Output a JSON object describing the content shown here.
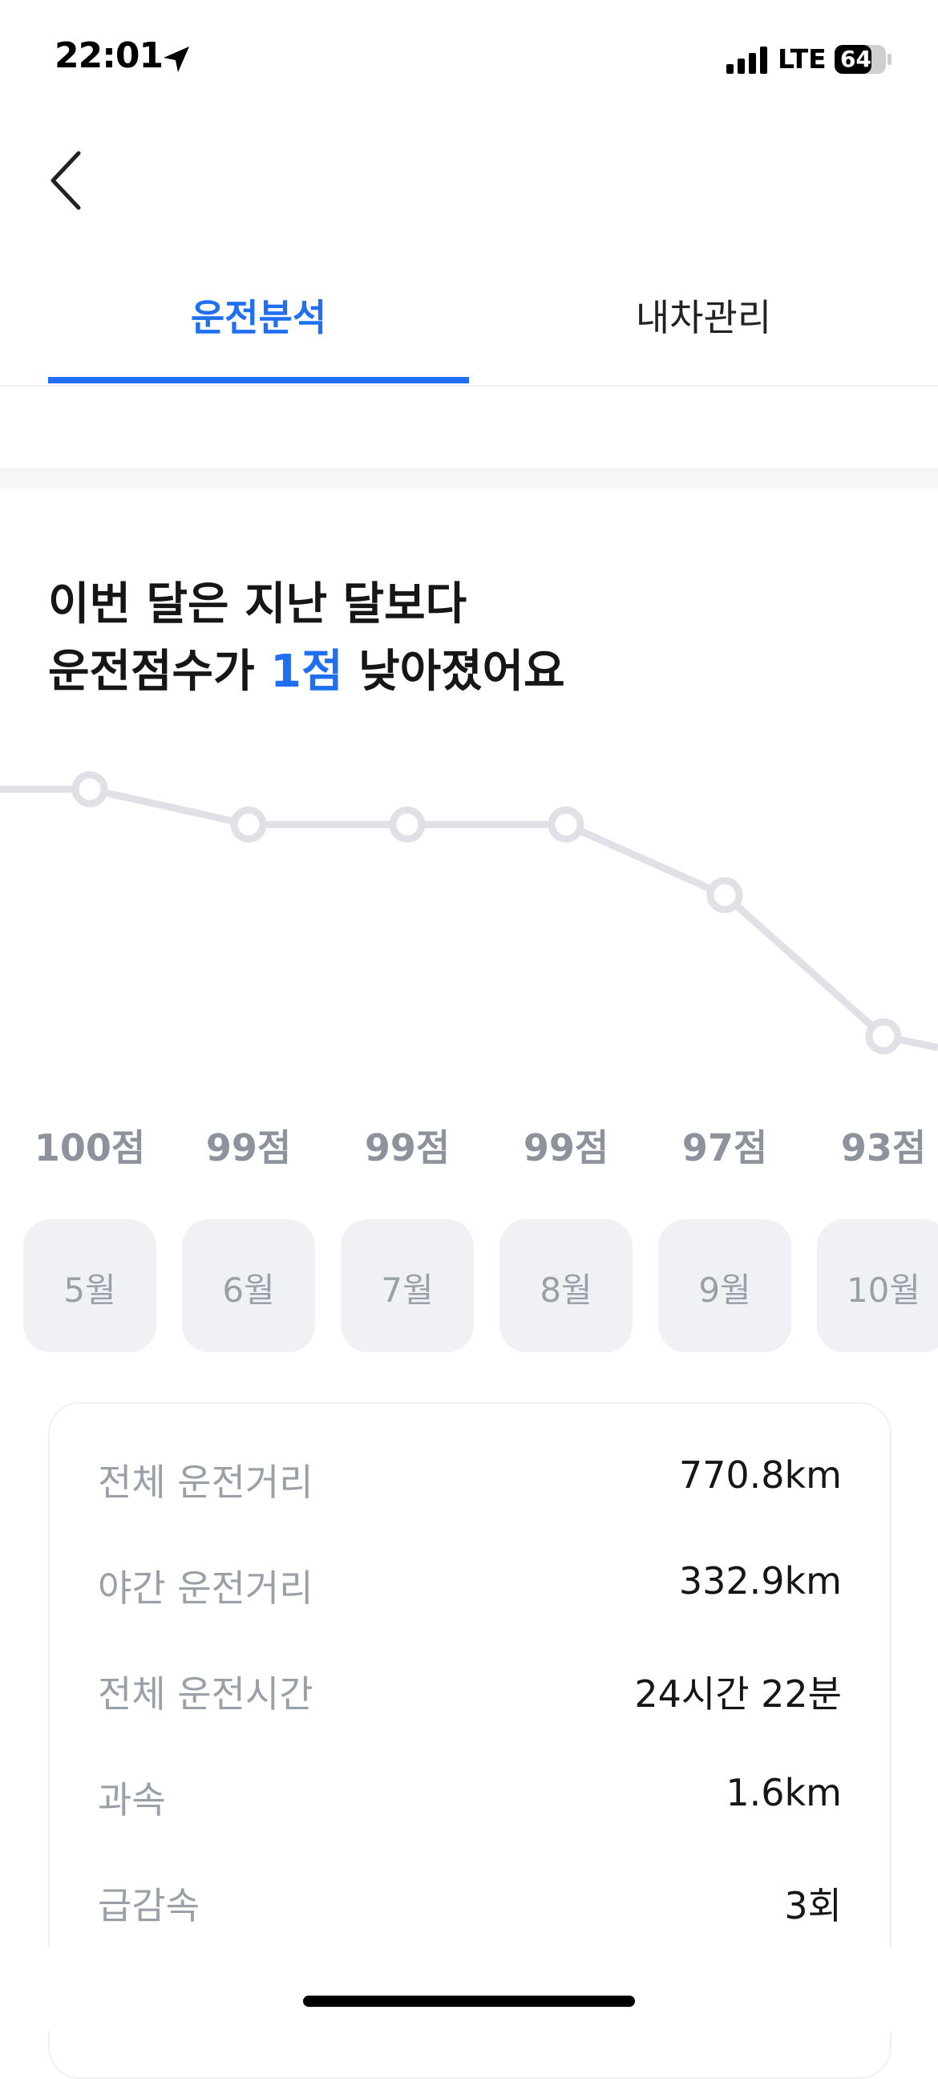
{
  "status_bar": {
    "time": "22:01",
    "network": "LTE",
    "battery": "64"
  },
  "tabs": [
    {
      "label": "운전분석",
      "active": true
    },
    {
      "label": "내차관리",
      "active": false
    }
  ],
  "headline": {
    "line1": "이번 달은 지난 달보다",
    "line2_prefix": "운전점수가 ",
    "line2_highlight": "1점",
    "line2_suffix": " 낮아졌어요"
  },
  "chart_data": {
    "type": "line",
    "x": [
      "5월",
      "6월",
      "7월",
      "8월",
      "9월",
      "10월"
    ],
    "values": [
      100,
      99,
      99,
      99,
      97,
      93
    ],
    "value_labels": [
      "100점",
      "99점",
      "99점",
      "99점",
      "97점",
      "93점"
    ]
  },
  "stats": [
    {
      "label": "전체 운전거리",
      "value": "770.8km"
    },
    {
      "label": "야간 운전거리",
      "value": "332.9km"
    },
    {
      "label": "전체 운전시간",
      "value": "24시간 22분"
    },
    {
      "label": "과속",
      "value": "1.6km"
    },
    {
      "label": "급감속",
      "value": "3회"
    }
  ],
  "colors": {
    "accent": "#1f6ff0",
    "chart_line": "#dfe1e7",
    "chip_bg": "#eff1f5",
    "muted_text": "#9aa0a8"
  }
}
